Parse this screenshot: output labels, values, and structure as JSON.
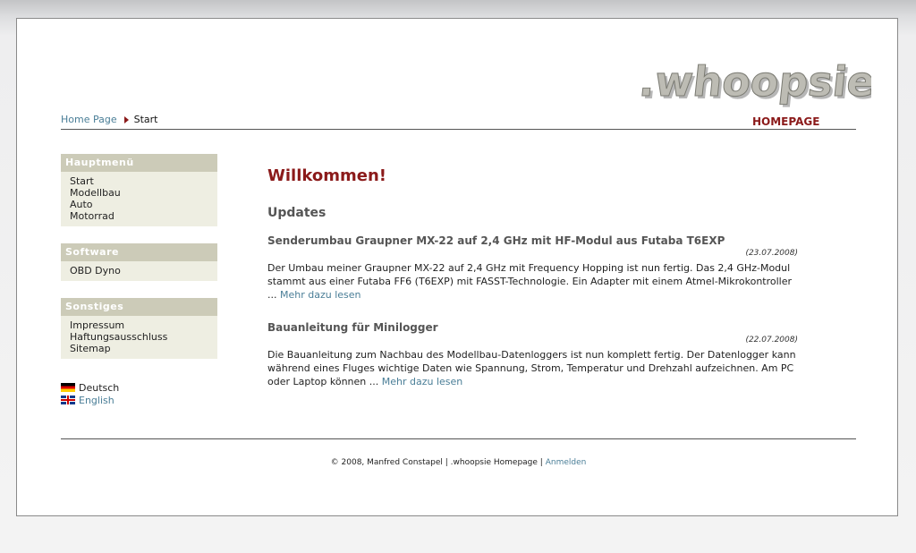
{
  "logo": {
    "main": ".whoopsie",
    "sub": "HOMEPAGE"
  },
  "breadcrumb": {
    "home": "Home Page",
    "current": "Start"
  },
  "menus": {
    "main": {
      "title": "Hauptmenü",
      "items": [
        "Start",
        "Modellbau",
        "Auto",
        "Motorrad"
      ]
    },
    "software": {
      "title": "Software",
      "items": [
        "OBD Dyno"
      ]
    },
    "misc": {
      "title": "Sonstiges",
      "items": [
        "Impressum",
        "Haftungsausschluss",
        "Sitemap"
      ]
    }
  },
  "languages": [
    {
      "label": "Deutsch",
      "icon": "german-flag-icon"
    },
    {
      "label": "English",
      "icon": "uk-flag-icon"
    }
  ],
  "main": {
    "title": "Willkommen!",
    "section": "Updates",
    "news": [
      {
        "title": "Senderumbau Graupner MX-22 auf 2,4 GHz mit HF-Modul aus Futaba T6EXP",
        "date": "(23.07.2008)",
        "text": "Der Umbau meiner Graupner MX-22 auf 2,4 GHz mit Frequency Hopping ist nun fertig. Das 2,4 GHz-Modul stammt aus einer Futaba FF6 (T6EXP) mit FASST-Technologie. Ein Adapter mit einem Atmel-Mikrokontroller ... ",
        "more": "Mehr dazu lesen"
      },
      {
        "title": "Bauanleitung für Minilogger",
        "date": "(22.07.2008)",
        "text": "Die Bauanleitung zum Nachbau des Modellbau-Datenloggers ist nun komplett fertig. Der Datenlogger kann während eines Fluges wichtige Daten wie Spannung, Strom, Temperatur und Drehzahl aufzeichnen. Am PC oder Laptop können ... ",
        "more": "Mehr dazu lesen"
      }
    ]
  },
  "footer": {
    "text": "© 2008, Manfred Constapel | .whoopsie Homepage | ",
    "login": "Anmelden"
  },
  "colors": {
    "accent": "#8b1a1a",
    "link": "#4a7e97",
    "menu_head": "#cccbb8",
    "menu_bg": "#eeeee2"
  }
}
